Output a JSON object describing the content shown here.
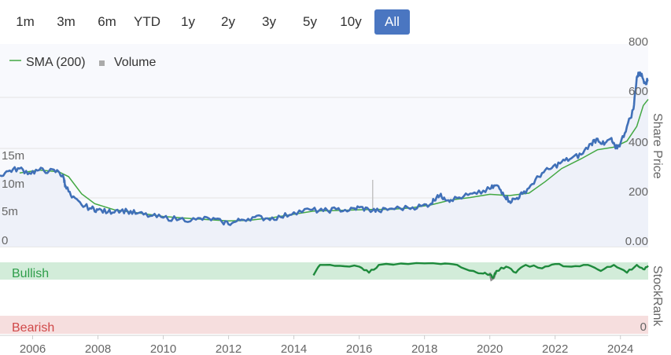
{
  "range_buttons": [
    {
      "label": "1m",
      "active": false
    },
    {
      "label": "3m",
      "active": false
    },
    {
      "label": "6m",
      "active": false
    },
    {
      "label": "YTD",
      "active": false
    },
    {
      "label": "1y",
      "active": false
    },
    {
      "label": "2y",
      "active": false
    },
    {
      "label": "3y",
      "active": false
    },
    {
      "label": "5y",
      "active": false
    },
    {
      "label": "10y",
      "active": false
    },
    {
      "label": "All",
      "active": true
    }
  ],
  "legend": {
    "sma_label": "SMA (200)",
    "volume_label": "Volume"
  },
  "colors": {
    "price": "#4070b8",
    "sma": "#43a843",
    "volume": "#c4c4c4",
    "stockrank_line": "#1e8a3c",
    "stockrank_dip": "#8a8a8a",
    "bullish_band": "#d2ecd9",
    "bearish_band": "#f6dede",
    "bullish_text": "#2e9e4a",
    "bearish_text": "#d04848",
    "active_button": "#4a76c1"
  },
  "chart_data": [
    {
      "type": "line",
      "x_axis": {
        "ticks": [
          "2006",
          "2008",
          "2010",
          "2012",
          "2014",
          "2016",
          "2018",
          "2020",
          "2022",
          "2024"
        ],
        "range": [
          2005.0,
          2024.85
        ]
      },
      "y_axis_price": {
        "title": "Share Price",
        "ticks": [
          "800",
          "600",
          "400",
          "200",
          "0.00"
        ],
        "range": [
          0,
          800
        ]
      },
      "y_axis_volume": {
        "ticks": [
          "15m",
          "10m",
          "5m",
          "0"
        ],
        "range": [
          0,
          15
        ]
      },
      "series": [
        {
          "name": "Price",
          "points": [
            [
              2005.0,
              290
            ],
            [
              2005.3,
              310
            ],
            [
              2005.6,
              318
            ],
            [
              2005.9,
              300
            ],
            [
              2006.2,
              312
            ],
            [
              2006.5,
              308
            ],
            [
              2006.8,
              305
            ],
            [
              2006.95,
              280
            ],
            [
              2007.0,
              250
            ],
            [
              2007.2,
              200
            ],
            [
              2007.5,
              170
            ],
            [
              2007.8,
              155
            ],
            [
              2008.0,
              150
            ],
            [
              2008.3,
              140
            ],
            [
              2008.6,
              150
            ],
            [
              2008.9,
              145
            ],
            [
              2009.2,
              135
            ],
            [
              2009.6,
              125
            ],
            [
              2010.0,
              118
            ],
            [
              2010.5,
              112
            ],
            [
              2011.0,
              110
            ],
            [
              2011.4,
              115
            ],
            [
              2011.8,
              100
            ],
            [
              2012.1,
              95
            ],
            [
              2012.4,
              110
            ],
            [
              2012.8,
              120
            ],
            [
              2013.2,
              115
            ],
            [
              2013.6,
              120
            ],
            [
              2014.0,
              140
            ],
            [
              2014.5,
              150
            ],
            [
              2014.9,
              145
            ],
            [
              2015.3,
              152
            ],
            [
              2015.7,
              148
            ],
            [
              2016.0,
              160
            ],
            [
              2016.3,
              150
            ],
            [
              2016.6,
              145
            ],
            [
              2017.0,
              155
            ],
            [
              2017.5,
              158
            ],
            [
              2017.9,
              165
            ],
            [
              2018.2,
              175
            ],
            [
              2018.4,
              210
            ],
            [
              2018.6,
              200
            ],
            [
              2018.8,
              190
            ],
            [
              2019.2,
              205
            ],
            [
              2019.6,
              215
            ],
            [
              2020.0,
              235
            ],
            [
              2020.2,
              250
            ],
            [
              2020.4,
              220
            ],
            [
              2020.6,
              185
            ],
            [
              2020.8,
              195
            ],
            [
              2021.0,
              215
            ],
            [
              2021.3,
              255
            ],
            [
              2021.6,
              300
            ],
            [
              2021.9,
              320
            ],
            [
              2022.2,
              345
            ],
            [
              2022.5,
              360
            ],
            [
              2022.8,
              375
            ],
            [
              2023.1,
              420
            ],
            [
              2023.3,
              440
            ],
            [
              2023.5,
              415
            ],
            [
              2023.7,
              440
            ],
            [
              2023.85,
              400
            ],
            [
              2024.0,
              420
            ],
            [
              2024.2,
              490
            ],
            [
              2024.4,
              560
            ],
            [
              2024.5,
              690
            ],
            [
              2024.6,
              710
            ],
            [
              2024.75,
              670
            ],
            [
              2024.85,
              675
            ]
          ]
        },
        {
          "name": "SMA (200)",
          "points": [
            [
              2005.6,
              300
            ],
            [
              2006.2,
              312
            ],
            [
              2006.8,
              305
            ],
            [
              2007.1,
              285
            ],
            [
              2007.5,
              215
            ],
            [
              2007.9,
              175
            ],
            [
              2008.5,
              150
            ],
            [
              2009.2,
              138
            ],
            [
              2010.0,
              123
            ],
            [
              2011.0,
              113
            ],
            [
              2012.0,
              105
            ],
            [
              2012.6,
              107
            ],
            [
              2013.3,
              117
            ],
            [
              2014.0,
              132
            ],
            [
              2014.6,
              145
            ],
            [
              2015.5,
              148
            ],
            [
              2016.3,
              151
            ],
            [
              2017.0,
              152
            ],
            [
              2017.6,
              158
            ],
            [
              2018.2,
              170
            ],
            [
              2018.8,
              190
            ],
            [
              2019.4,
              200
            ],
            [
              2020.0,
              213
            ],
            [
              2020.6,
              208
            ],
            [
              2021.2,
              218
            ],
            [
              2021.7,
              265
            ],
            [
              2022.2,
              318
            ],
            [
              2022.8,
              358
            ],
            [
              2023.3,
              395
            ],
            [
              2023.8,
              405
            ],
            [
              2024.2,
              430
            ],
            [
              2024.5,
              490
            ],
            [
              2024.7,
              575
            ],
            [
              2024.85,
              600
            ]
          ]
        }
      ]
    },
    {
      "type": "line",
      "title": "StockRank",
      "bands": {
        "bullish": "Bullish",
        "bearish": "Bearish"
      },
      "y_axis": {
        "ticks": [
          "0"
        ]
      },
      "series": [
        {
          "name": "StockRank",
          "points": [
            [
              2014.6,
              85
            ],
            [
              2014.8,
              97
            ],
            [
              2015.4,
              96
            ],
            [
              2016.0,
              95
            ],
            [
              2016.3,
              88
            ],
            [
              2016.6,
              97
            ],
            [
              2017.5,
              98
            ],
            [
              2018.5,
              98
            ],
            [
              2019.0,
              97
            ],
            [
              2019.5,
              90
            ],
            [
              2019.8,
              87
            ],
            [
              2020.0,
              86
            ],
            [
              2020.1,
              82
            ],
            [
              2020.2,
              90
            ],
            [
              2020.5,
              95
            ],
            [
              2020.8,
              88
            ],
            [
              2021.1,
              97
            ],
            [
              2021.6,
              93
            ],
            [
              2022.0,
              98
            ],
            [
              2022.5,
              95
            ],
            [
              2023.0,
              97
            ],
            [
              2023.4,
              90
            ],
            [
              2023.8,
              97
            ],
            [
              2024.2,
              88
            ],
            [
              2024.5,
              97
            ],
            [
              2024.7,
              92
            ],
            [
              2024.85,
              96
            ]
          ]
        }
      ]
    }
  ]
}
